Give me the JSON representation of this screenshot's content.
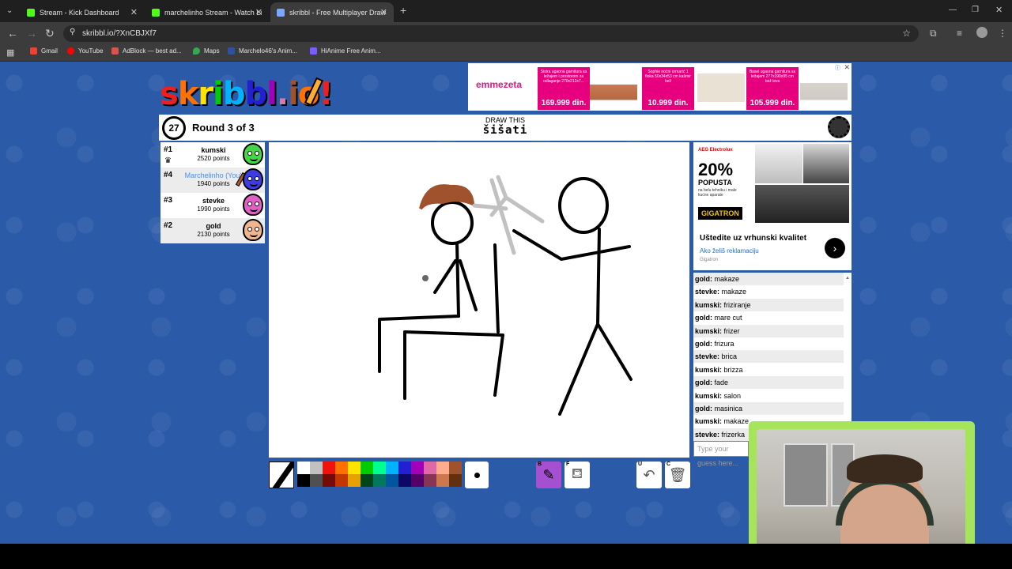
{
  "browser": {
    "tabs": [
      {
        "title": "Stream - Kick Dashboard",
        "color": "#53fc18"
      },
      {
        "title": "marchelinho Stream - Watch Li",
        "color": "#53fc18"
      },
      {
        "title": "skribbl - Free Multiplayer Draw",
        "color": "#7aa7ff"
      }
    ],
    "new_tab": "+",
    "url": "skribbl.io/?XnCBJXf7",
    "bookmarks": [
      "Gmail",
      "YouTube",
      "AdBlock — best ad...",
      "Maps",
      "Marchelo46's Anim...",
      "HiAnime Free Anim..."
    ]
  },
  "game": {
    "logo": [
      "s",
      "k",
      "r",
      "i",
      "b",
      "b",
      "l",
      ".",
      "i",
      "o",
      "!"
    ],
    "logo_colors": [
      "#ef1f1f",
      "#ff7100",
      "#ffe200",
      "#00cc00",
      "#00b2ff",
      "#231fd3",
      "#a300ba",
      "#d37caa",
      "#a0522d",
      "#ff7100",
      "#ef1f1f"
    ],
    "timer": "27",
    "round": "Round 3 of 3",
    "draw_this_label": "DRAW THIS",
    "word": "šišati",
    "players": [
      {
        "rank": "#1",
        "name": "kumski",
        "points": "2520 points",
        "color": "#45d645",
        "me": false
      },
      {
        "rank": "#4",
        "name": "Marchelinho (You)",
        "points": "1940 points",
        "color": "#3c3ce0",
        "me": true
      },
      {
        "rank": "#3",
        "name": "stevke",
        "points": "1990 points",
        "color": "#e060c8",
        "me": false
      },
      {
        "rank": "#2",
        "name": "gold",
        "points": "2130 points",
        "color": "#f0b58a",
        "me": false
      }
    ],
    "palette": [
      "#ffffff",
      "#c1c1c1",
      "#ef130b",
      "#ff7100",
      "#ffe400",
      "#00cc00",
      "#00ff91",
      "#00b2ff",
      "#231fd3",
      "#a300ba",
      "#df69a7",
      "#ffac8e",
      "#a0522d",
      "#000000",
      "#505050",
      "#740b07",
      "#c23800",
      "#e8a200",
      "#004619",
      "#00785d",
      "#00569e",
      "#0e0865",
      "#550069",
      "#873554",
      "#cc774d",
      "#63300d"
    ],
    "tools": {
      "brush_key": "B",
      "fill_key": "F",
      "undo_key": "U",
      "clear_key": "C"
    },
    "chat": [
      {
        "user": "gold",
        "text": "makaze"
      },
      {
        "user": "stevke",
        "text": "makaze"
      },
      {
        "user": "kumski",
        "text": "friziranje"
      },
      {
        "user": "gold",
        "text": "mare cut"
      },
      {
        "user": "kumski",
        "text": "frizer"
      },
      {
        "user": "gold",
        "text": "frizura"
      },
      {
        "user": "stevke",
        "text": "brica"
      },
      {
        "user": "kumski",
        "text": "brizza"
      },
      {
        "user": "gold",
        "text": "fade"
      },
      {
        "user": "kumski",
        "text": "salon"
      },
      {
        "user": "gold",
        "text": "masinica"
      },
      {
        "user": "kumski",
        "text": "makaze"
      },
      {
        "user": "stevke",
        "text": "frizerka"
      }
    ],
    "chat_placeholder": "Type your guess here..."
  },
  "ads": {
    "top": {
      "brand": "emmezeta",
      "items": [
        {
          "desc": "Sistra ugaona garnitura sa ležajem i prostorom za odlaganje 270x212x7...",
          "price": "169.999 din."
        },
        {
          "desc": "Sophie noćni ormarić 1 fioka 50x34x53 cm kašmir bež",
          "price": "10.999 din."
        },
        {
          "desc": "Basel ugaona garnitura sa ležajem 277x190x95 cm bež leva",
          "price": "105.999 din."
        }
      ]
    },
    "side": {
      "aeg": "AEG Electrolux",
      "pct": "20%",
      "popusta": "POPUSTA",
      "sub": "na belu tehniku i male kućne aparate",
      "gigatron": "GIGATRON",
      "headline": "Uštedite uz vrhunski kvalitet",
      "link": "Ako želiš reklamaciju",
      "brand": "Gigatron",
      "arrow": "›"
    }
  }
}
